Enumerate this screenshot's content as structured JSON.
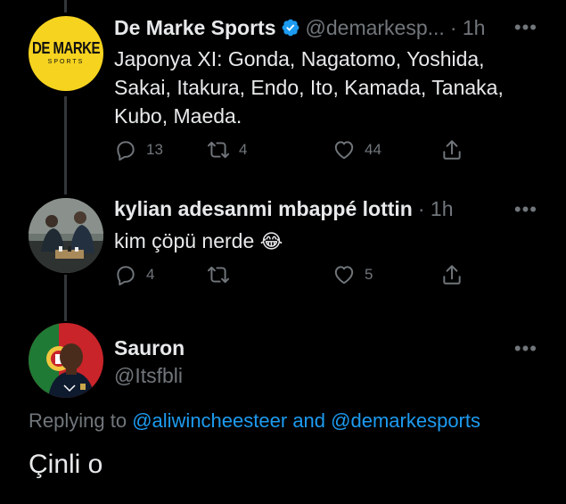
{
  "tweets": [
    {
      "name": "De Marke Sports",
      "handle": "@demarkesp...",
      "time": "· 1h",
      "verified": true,
      "avatar_logo_lines": [
        "DE MARKE",
        "SPORTS"
      ],
      "text": [
        "Japonya XI: Gonda, Nagatomo, Yoshida,",
        "Sakai, Itakura, Endo, Ito, Kamada, Tanaka,",
        "Kubo, Maeda."
      ],
      "replies": "13",
      "retweets": "4",
      "likes": "44"
    },
    {
      "name": "kylian adesanmi mbappé lottin",
      "time": "· 1h",
      "text": "kim çöpü nerde",
      "emoji": "😂",
      "replies": "4",
      "retweets": "",
      "likes": "5"
    }
  ],
  "main_tweet": {
    "name": "Sauron",
    "handle": "@Itsfbli",
    "replying_prefix": "Replying to",
    "replying_user1": "@aliwincheesteer",
    "replying_and": "and",
    "replying_user2": "@demarkesports",
    "text": "Çinli o"
  },
  "colors": {
    "background": "#000000",
    "text": "#e7e9ea",
    "muted": "#71767b",
    "accent": "#1d9bf0",
    "logo_yellow": "#f6d31f"
  },
  "icons": [
    "reply-icon",
    "retweet-icon",
    "like-icon",
    "share-icon",
    "more-icon",
    "verified-badge-icon"
  ]
}
